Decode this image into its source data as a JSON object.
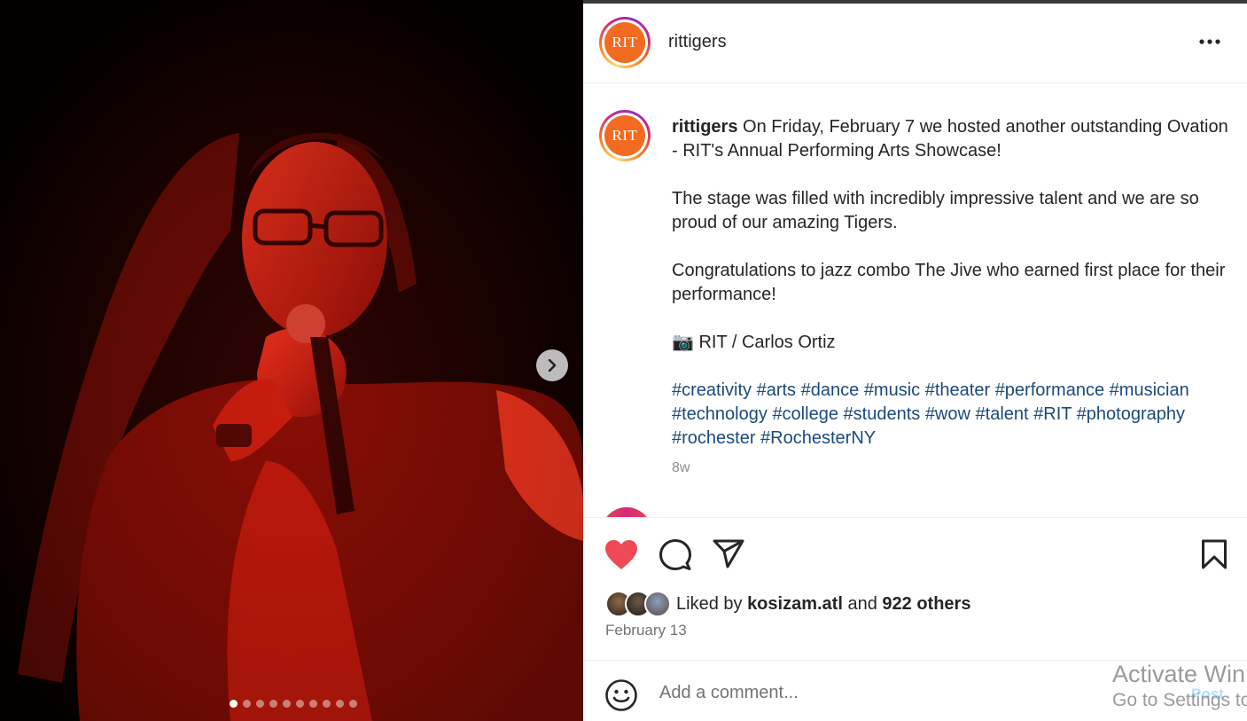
{
  "post": {
    "username": "rittigers",
    "avatar_text": "RIT",
    "caption_paragraphs": [
      "On Friday, February 7 we hosted another outstanding Ovation - RIT's Annual Performing Arts Showcase!",
      "The stage was filled with incredibly impressive talent and we are so proud of our amazing Tigers.",
      "Congratulations to jazz combo The Jive who earned first place for their performance!",
      "📷 RIT / Carlos Ortiz"
    ],
    "hashtags": [
      "#creativity",
      "#arts",
      "#dance",
      "#music",
      "#theater",
      "#performance",
      "#musician",
      "#technology",
      "#college",
      "#students",
      "#wow",
      "#talent",
      "#RIT",
      "#photography",
      "#rochester",
      "#RochesterNY"
    ],
    "age": "8w",
    "liked_prefix": "Liked by",
    "liked_user": "kosizam.atl",
    "liked_and": "and",
    "liked_others": "922 others",
    "date": "February 13"
  },
  "carousel": {
    "total": 10,
    "current": 1
  },
  "comment": {
    "placeholder": "Add a comment...",
    "post_label": "Post"
  },
  "icons": [
    "more-options-icon",
    "chevron-right-icon",
    "heart-icon",
    "comment-icon",
    "share-icon",
    "bookmark-icon",
    "emoji-icon"
  ],
  "colors": {
    "like": "#ed4956",
    "hashtag": "#1c4a7e",
    "brand": "#f26b21"
  },
  "watermark": {
    "line1": "Activate Win",
    "line2": "Go to Settings to"
  }
}
